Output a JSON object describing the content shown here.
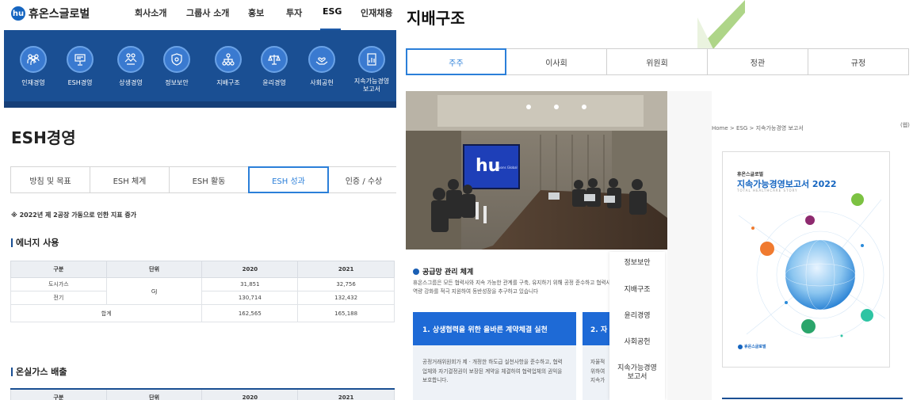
{
  "header": {
    "logo_mark": "hu",
    "logo_text": "휴온스글로벌",
    "nav": [
      "회사소개",
      "그룹사 소개",
      "홍보",
      "투자",
      "ESG",
      "인재채용"
    ],
    "nav_active": "ESG"
  },
  "mega_menu": [
    {
      "label": "인재경영",
      "icon": "people-icon"
    },
    {
      "label": "ESH경영",
      "icon": "presentation-icon"
    },
    {
      "label": "상생경영",
      "icon": "handshake-icon"
    },
    {
      "label": "정보보안",
      "icon": "shield-icon"
    },
    {
      "label": "지배구조",
      "icon": "org-chart-icon"
    },
    {
      "label": "윤리경영",
      "icon": "scales-icon"
    },
    {
      "label": "사회공헌",
      "icon": "heart-hands-icon"
    },
    {
      "label": "지속가능경영\n보고서",
      "icon": "report-icon"
    }
  ],
  "esh": {
    "title": "ESH경영",
    "tabs": [
      "방침 및 목표",
      "ESH 체계",
      "ESH 활동",
      "ESH 성과",
      "인증 / 수상"
    ],
    "active_tab": "ESH 성과",
    "note": "※ 2022년 제 2공장 가동으로 인한 지표 증가",
    "energy": {
      "title": "에너지 사용",
      "headers": [
        "구분",
        "단위",
        "2020",
        "2021"
      ],
      "rows": [
        {
          "name": "도시가스",
          "y2020": "31,851",
          "y2021": "32,756"
        },
        {
          "name": "전기",
          "y2020": "130,714",
          "y2021": "132,432"
        }
      ],
      "unit": "GJ",
      "total": {
        "name": "합계",
        "y2020": "162,565",
        "y2021": "165,188"
      }
    },
    "ghg": {
      "title": "온실가스 배출",
      "headers": [
        "구분",
        "단위",
        "2020",
        "2021"
      ]
    }
  },
  "governance": {
    "title": "지배구조",
    "tabs": [
      "주주",
      "이사회",
      "위원회",
      "정관",
      "규정"
    ],
    "active_tab": "주주"
  },
  "photo": {
    "screen_logo": "hu",
    "screen_text": "Huons Global"
  },
  "supply": {
    "title": "공급망 관리 체계",
    "desc": "휴온스그룹은 모든 협력사와 지속 가능한 관계를 구축, 유지하기 위해 공정 준수하고 협력사 역량 강화를 적극 지원하여 동반성장을 추구하고 있습니다",
    "card1_title": "1. 상생협력을 위한 올바른 계약체결 실천",
    "card1_body": "공정거래위원회가 제 · 개정한 하도급 실천사항을 준수하고, 협력업체와 자기결정권이 보장된 계약을 체결하여 협력업체의 권익을 보호합니다.",
    "card2_title": "2. 자",
    "card2_body": "자율적 위하여 지속가"
  },
  "submenu": [
    "정보보안",
    "지배구조",
    "윤리경영",
    "사회공헌",
    "지속가능경영\n보고서"
  ],
  "report": {
    "breadcrumb": "Home > ESG > 지속가능경영 보고서",
    "breadcrumb_right": "(웹)",
    "company": "휴온스글로벌",
    "title": "지속가능경영보고서 2022",
    "subtitle": "TOTAL HEALTHCARE STORY",
    "logo": "휴온스글로벌"
  },
  "colors": {
    "primary": "#1a4f93",
    "accent": "#2b7fd9",
    "card": "#1e6ad6",
    "green": "#9acb6a"
  }
}
